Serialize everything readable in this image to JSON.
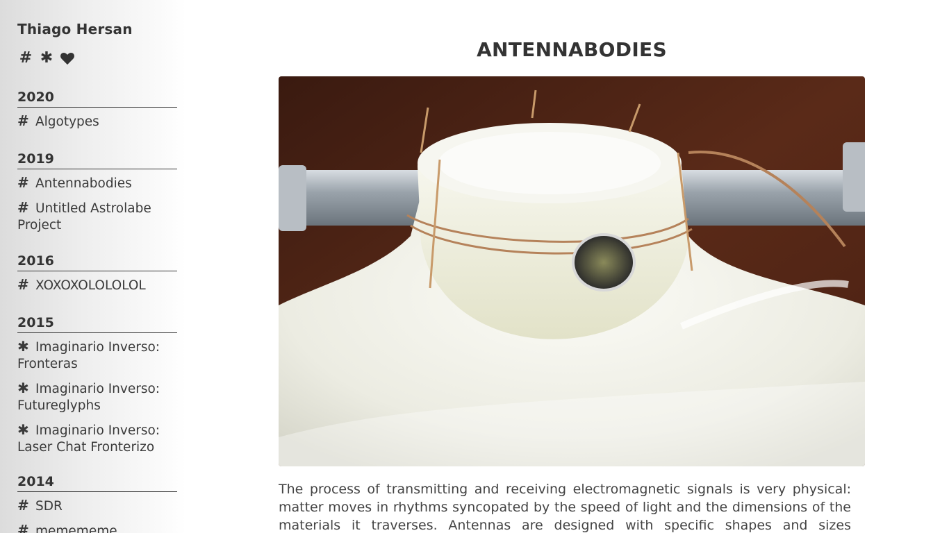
{
  "site": {
    "name": "Thiago Hersan"
  },
  "filters": [
    {
      "symbol": "#",
      "icon": "hash-icon"
    },
    {
      "symbol": "✱",
      "icon": "asterisk-icon"
    },
    {
      "symbol": "",
      "icon": "heart-icon"
    }
  ],
  "nav": [
    {
      "year": "2020",
      "items": [
        {
          "tag": "#",
          "label": "Algotypes"
        }
      ]
    },
    {
      "year": "2019",
      "items": [
        {
          "tag": "#",
          "label": "Antennabodies"
        },
        {
          "tag": "#",
          "label": "Untitled Astrolabe Project"
        }
      ]
    },
    {
      "year": "2016",
      "items": [
        {
          "tag": "#",
          "label": "XOXOXOLOLOLOL"
        }
      ]
    },
    {
      "year": "2015",
      "items": [
        {
          "tag": "✱",
          "label": "Imaginario Inverso: Fronteras"
        },
        {
          "tag": "✱",
          "label": "Imaginario Inverso: Futureglyphs"
        },
        {
          "tag": "✱",
          "label": "Imaginario Inverso: Laser Chat Fronterizo"
        }
      ]
    },
    {
      "year": "2014",
      "items": [
        {
          "tag": "#",
          "label": "SDR"
        },
        {
          "tag": "#",
          "label": "memememe"
        }
      ]
    }
  ],
  "main": {
    "title": "ANTENNABODIES",
    "description": "The process of transmitting and receiving electromagnetic signals is very physical: matter moves in rhythms syncopated by the speed of light and the dimensions of the materials it traverses. Antennas are designed with specific shapes and sizes optimized"
  },
  "colors": {
    "text": "#333333",
    "sidebar_gradient_start": "#dcdcdc",
    "background": "#ffffff"
  }
}
